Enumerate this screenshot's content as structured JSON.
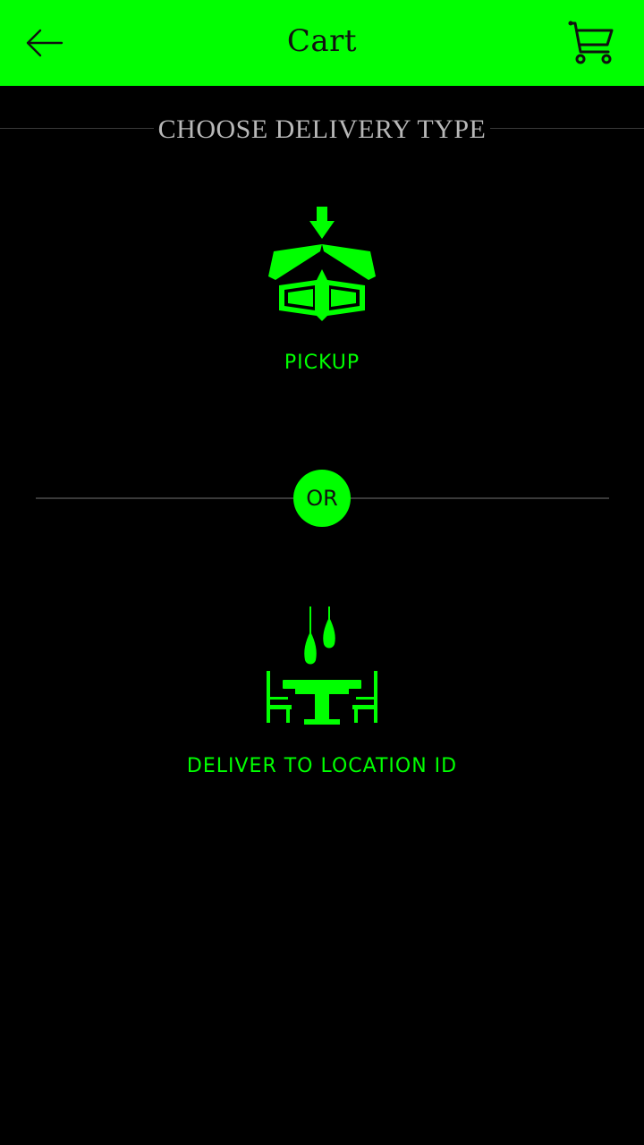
{
  "header": {
    "title": "Cart",
    "back_icon": "arrow-left-icon",
    "cart_icon": "shopping-cart-icon"
  },
  "section": {
    "title": "CHOOSE DELIVERY TYPE"
  },
  "options": [
    {
      "label": "PICKUP",
      "icon": "open-box-icon"
    },
    {
      "label": "DELIVER TO LOCATION ID",
      "icon": "dining-table-icon"
    }
  ],
  "divider": {
    "label": "OR"
  },
  "colors": {
    "accent": "#00ff00",
    "background": "#000000",
    "header_text": "#111111",
    "section_title": "#b8b8b8",
    "rule": "#3a3a3a"
  }
}
